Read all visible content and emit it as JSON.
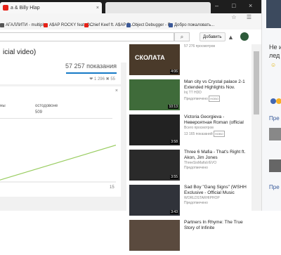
{
  "browser": {
    "tab_active_title": "а & Billy Hlap",
    "tab_active_close": "×",
    "tab_inactive_title": "",
    "window_controls": [
      "–",
      "□",
      "×"
    ],
    "address_icons": "☆ ☰",
    "bookmarks": [
      {
        "label": "АГАЛЛИТИ - multiple",
        "color": "#555555"
      },
      {
        "label": "A$AP ROCKY feat. O...",
        "color": "#e62117"
      },
      {
        "label": "Chief Keef ft. A$AP R...",
        "color": "#e62117"
      },
      {
        "label": "Object Debugger - F...",
        "color": "#3b5998"
      },
      {
        "label": "Добро пожаловать...",
        "color": "#3b5998"
      }
    ]
  },
  "header": {
    "search_button_icon": "⌕",
    "add_button": "Добавить",
    "bell_icon": "▲"
  },
  "video": {
    "title": "icial video)",
    "views": "57 257 показания",
    "likes": "❤ 1 296   ✖ 55"
  },
  "stats": {
    "close_icon": "×",
    "col1_label": "ны",
    "col2_label": "остодовоне",
    "col2_value": "509",
    "x_tick_end": "15"
  },
  "chart_data": {
    "type": "line",
    "x": [
      0,
      1
    ],
    "series": [
      {
        "values": [
          0.06,
          0.68
        ]
      }
    ],
    "color": "#9acd62"
  },
  "sidebar": {
    "items": [
      {
        "title": "СКОЛАТА",
        "sub1": "57 276 просмотров",
        "sub2": "",
        "badge": "",
        "duration": "4:06",
        "thumb_color": "#4a3a2a"
      },
      {
        "title": "Man city vs Crystal palace 2-1 Extended Highlights Nov.",
        "sub1": "Inj TT HDD",
        "sub2": "Предотмечено",
        "badge": "HOBO",
        "duration": "10:13",
        "thumb_color": "#3f6b3a"
      },
      {
        "title": "Victoria Georgieva - Невероятная Roman (official",
        "sub1": "Всего просмотров",
        "sub2": "13 165 показаний",
        "badge": "HOBO",
        "duration": "3:58",
        "thumb_color": "#222222"
      },
      {
        "title": "Three 6 Mafia - That's Right ft. Akon, Jim Jones",
        "sub1": "ThreeSixMafiaVEVO",
        "sub2": "Предотмечено",
        "badge": "",
        "duration": "3:55",
        "thumb_color": "#2a2a2a"
      },
      {
        "title": "Sad Boy \"Gang Signs\" (WSHH Exclusive - Official Music",
        "sub1": "WORLDSTARHIPHOP",
        "sub2": "Предотмечено",
        "badge": "",
        "duration": "3:43",
        "thumb_color": "#30333a"
      },
      {
        "title": "Partners In Rhyme: The True Story of Infinite",
        "sub1": "",
        "sub2": "",
        "badge": "",
        "duration": "",
        "thumb_color": "#5a4a3e"
      }
    ]
  },
  "right_panel": {
    "text1": "Не и",
    "text2": "лед",
    "emoji": "☺",
    "link1": "Пре",
    "link2": "Пре"
  }
}
